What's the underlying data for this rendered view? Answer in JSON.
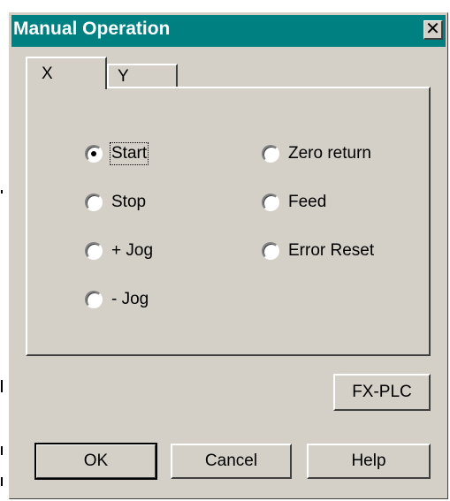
{
  "window": {
    "title": "Manual Operation",
    "close_glyph": "✕"
  },
  "tabs": [
    {
      "label": "X",
      "active": true
    },
    {
      "label": "Y",
      "active": false
    }
  ],
  "radios": {
    "left": [
      {
        "label": "Start",
        "checked": true
      },
      {
        "label": "Stop",
        "checked": false
      },
      {
        "label": "+ Jog",
        "checked": false
      },
      {
        "label": "- Jog",
        "checked": false
      }
    ],
    "right": [
      {
        "label": "Zero return",
        "checked": false
      },
      {
        "label": "Feed",
        "checked": false
      },
      {
        "label": "Error Reset",
        "checked": false
      }
    ]
  },
  "buttons": {
    "fx_plc": "FX-PLC",
    "ok": "OK",
    "cancel": "Cancel",
    "help": "Help"
  }
}
